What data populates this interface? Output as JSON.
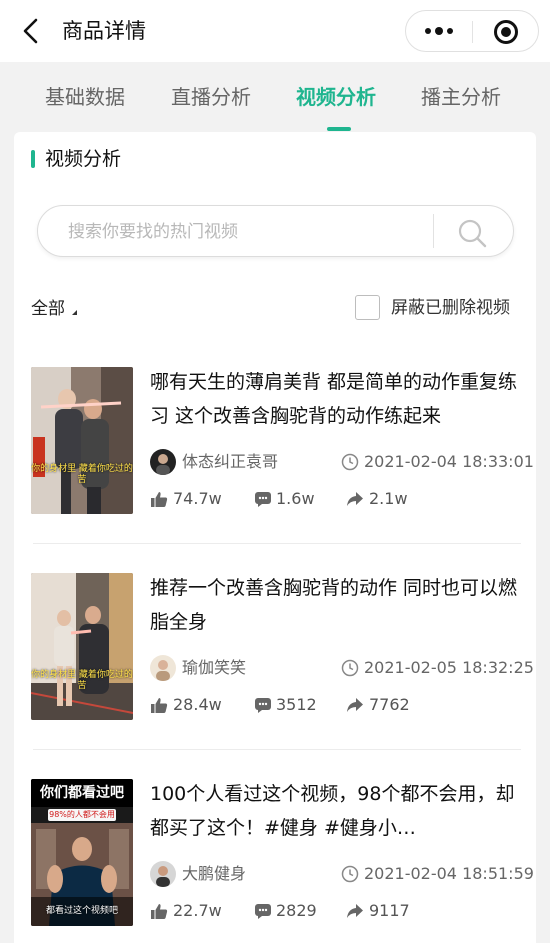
{
  "navbar": {
    "title": "商品详情"
  },
  "tabs": [
    {
      "label": "基础数据",
      "active": false
    },
    {
      "label": "直播分析",
      "active": false
    },
    {
      "label": "视频分析",
      "active": true
    },
    {
      "label": "播主分析",
      "active": false
    }
  ],
  "section": {
    "title": "视频分析"
  },
  "search": {
    "placeholder": "搜索你要找的热门视频"
  },
  "filter": {
    "sort_label": "全部",
    "hide_deleted_label": "屏蔽已删除视频",
    "hide_deleted_checked": false
  },
  "videos": [
    {
      "title": "哪有天生的薄肩美背 都是简单的动作重复练习 这个改善含胸驼背的动作练起来",
      "author": "体态纠正袁哥",
      "time": "2021-02-04 18:33:01",
      "likes": "74.7w",
      "comments": "1.6w",
      "shares": "2.1w",
      "thumb_caption": "你的身材里 藏着你吃过的苦"
    },
    {
      "title": "推荐一个改善含胸驼背的动作 同时也可以燃脂全身",
      "author": "瑜伽笑笑",
      "time": "2021-02-05 18:32:25",
      "likes": "28.4w",
      "comments": "3512",
      "shares": "7762",
      "thumb_caption": "你的身材里 藏着你吃过的苦"
    },
    {
      "title": "100个人看过这个视频，98个都不会用，却都买了这个！#健身 #健身小…",
      "author": "大鹏健身",
      "time": "2021-02-04 18:51:59",
      "likes": "22.7w",
      "comments": "2829",
      "shares": "9117",
      "thumb_top": "你们都看过吧",
      "thumb_badge": "98%的人都不会用",
      "thumb_caption": "都看过这个视频吧"
    }
  ],
  "colors": {
    "accent": "#1fb58f",
    "background": "#f2f2f2"
  }
}
